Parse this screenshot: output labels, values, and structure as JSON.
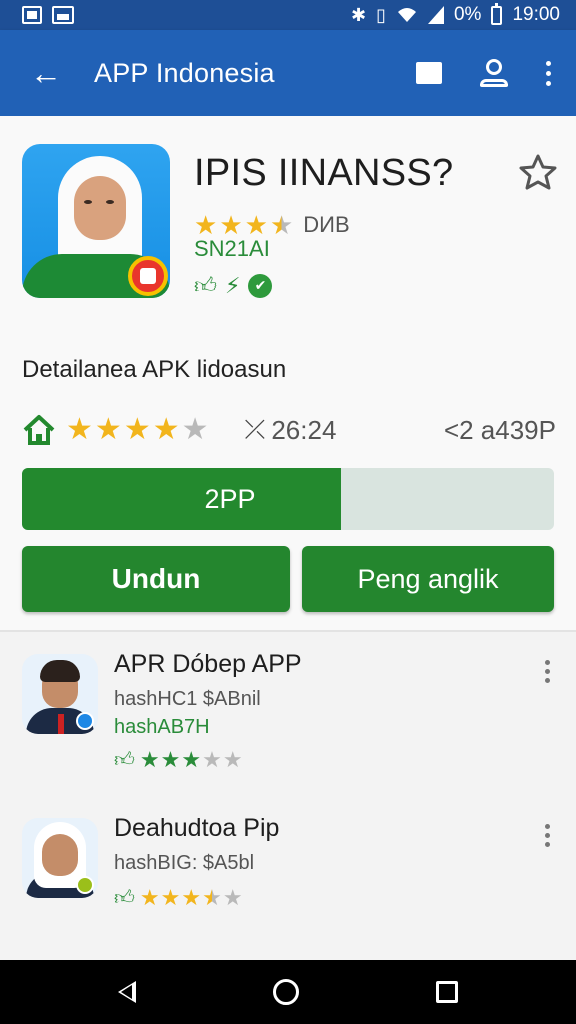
{
  "status_bar": {
    "battery_text": "0%",
    "time": "19:00",
    "icons": [
      "screenshot-icon",
      "gallery-icon",
      "bluetooth-icon",
      "vibrate-icon",
      "wifi-icon",
      "signal-icon",
      "battery-icon"
    ]
  },
  "app_bar": {
    "title": "APP Indonesia",
    "icons": [
      "back-arrow-icon",
      "square-icon",
      "account-icon",
      "more-vert-icon"
    ]
  },
  "hero": {
    "title": "IPIS IINANSS?",
    "rating_stars": 3.5,
    "rating_text": "DИB",
    "subtitle": "SN21AI",
    "badge_text": "ᗅ ⁴ ✔"
  },
  "details": {
    "title": "Detailanea APK lidoasun",
    "stars": 4,
    "count": "26:24",
    "size": "<2 a439P"
  },
  "progress": {
    "label": "2PP",
    "fraction": 0.6
  },
  "buttons": {
    "install": "Undun",
    "open": "Peng anglik"
  },
  "list": [
    {
      "title": "APR Dóbep APP",
      "meta": "hashHC1 $ABnil",
      "meta2": "hashAB7H",
      "stars": 3,
      "kind": "man",
      "badge_color": "#1e88e5"
    },
    {
      "title": "Deahudtoa Pip",
      "meta": "hashBIG: $A5bl",
      "meta2": "",
      "stars": 3.5,
      "kind": "woman",
      "badge_color": "#9bbf1a"
    }
  ],
  "nav_bar": {
    "icons": [
      "nav-back-icon",
      "nav-home-icon",
      "nav-recent-icon"
    ]
  },
  "colors": {
    "status_bar": "#1e4f96",
    "app_bar": "#2161b6",
    "primary_green": "#24862e",
    "star_yellow": "#f2b51d"
  }
}
